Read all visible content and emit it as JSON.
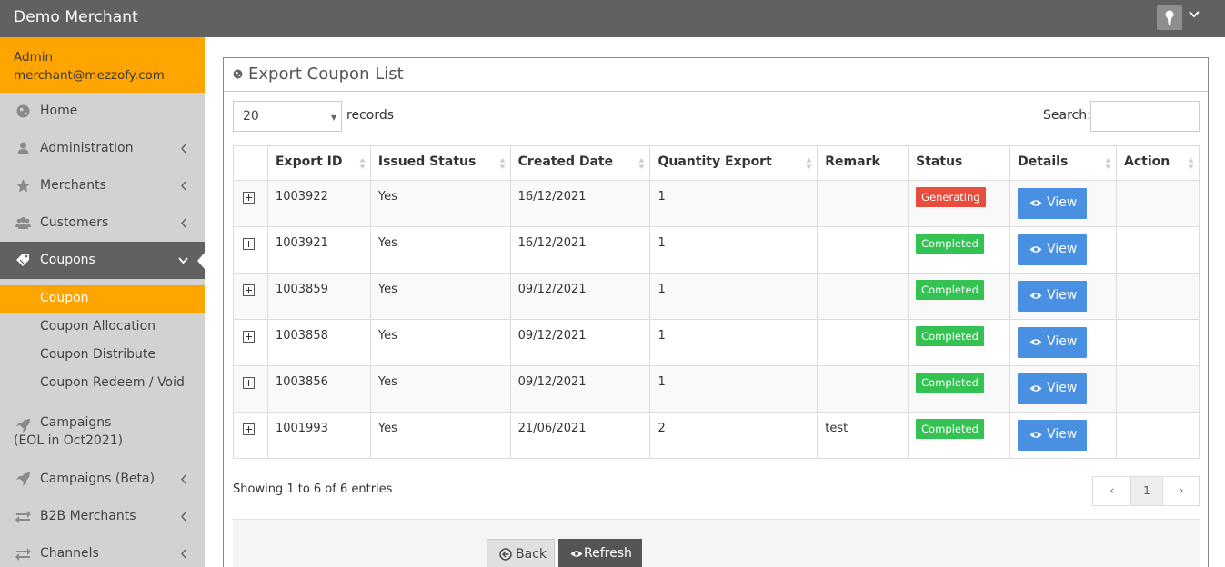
{
  "header": {
    "brand": "Demo Merchant",
    "icons": [
      "keyhole-icon",
      "chevron-down-icon"
    ]
  },
  "sidebar": {
    "user": {
      "role": "Admin",
      "email": "merchant@mezzofy.com"
    },
    "items": [
      {
        "label": "Home",
        "icon": "globe-icon"
      },
      {
        "label": "Administration",
        "icon": "user-icon"
      },
      {
        "label": "Merchants",
        "icon": "star-icon"
      },
      {
        "label": "Customers",
        "icon": "users-icon"
      },
      {
        "label": "Coupons",
        "icon": "tags-icon"
      }
    ],
    "sub_items": [
      "Coupon",
      "Coupon Allocation",
      "Coupon Distribute",
      "Coupon Redeem / Void"
    ],
    "campaigns_eol": {
      "line1": "Campaigns",
      "line2": "(EOL in Oct2021)"
    },
    "lower_items": [
      {
        "label": "Campaigns (Beta)",
        "icon": "rocket-icon"
      },
      {
        "label": "B2B Merchants",
        "icon": "exchange-icon"
      },
      {
        "label": "Channels",
        "icon": "exchange-icon"
      }
    ]
  },
  "panel": {
    "title": "Export Coupon List",
    "length_value": "20",
    "length_label": "records",
    "search_label": "Search:",
    "search_value": "",
    "columns": [
      "Export ID",
      "Issued Status",
      "Created Date",
      "Quantity Export",
      "Remark",
      "Status",
      "Details",
      "Action"
    ],
    "rows": [
      {
        "id": "1003922",
        "issued": "Yes",
        "date": "16/12/2021",
        "qty": "1",
        "remark": "",
        "status": "Generating",
        "details": "View",
        "action": ""
      },
      {
        "id": "1003921",
        "issued": "Yes",
        "date": "16/12/2021",
        "qty": "1",
        "remark": "",
        "status": "Completed",
        "details": "View",
        "action": ""
      },
      {
        "id": "1003859",
        "issued": "Yes",
        "date": "09/12/2021",
        "qty": "1",
        "remark": "",
        "status": "Completed",
        "details": "View",
        "action": ""
      },
      {
        "id": "1003858",
        "issued": "Yes",
        "date": "09/12/2021",
        "qty": "1",
        "remark": "",
        "status": "Completed",
        "details": "View",
        "action": ""
      },
      {
        "id": "1003856",
        "issued": "Yes",
        "date": "09/12/2021",
        "qty": "1",
        "remark": "",
        "status": "Completed",
        "details": "View",
        "action": ""
      },
      {
        "id": "1001993",
        "issued": "Yes",
        "date": "21/06/2021",
        "qty": "2",
        "remark": "test",
        "status": "Completed",
        "details": "View",
        "action": ""
      }
    ],
    "info": "Showing 1 to 6 of 6 entries",
    "pagination": {
      "prev": "‹",
      "page": "1",
      "next": "›"
    },
    "buttons": {
      "back": "Back",
      "refresh": "Refresh"
    }
  },
  "colors": {
    "topbar": "#616161",
    "accent": "#ffa500",
    "generating": "#e74c3c",
    "completed": "#34c352",
    "view": "#4a90e2"
  }
}
